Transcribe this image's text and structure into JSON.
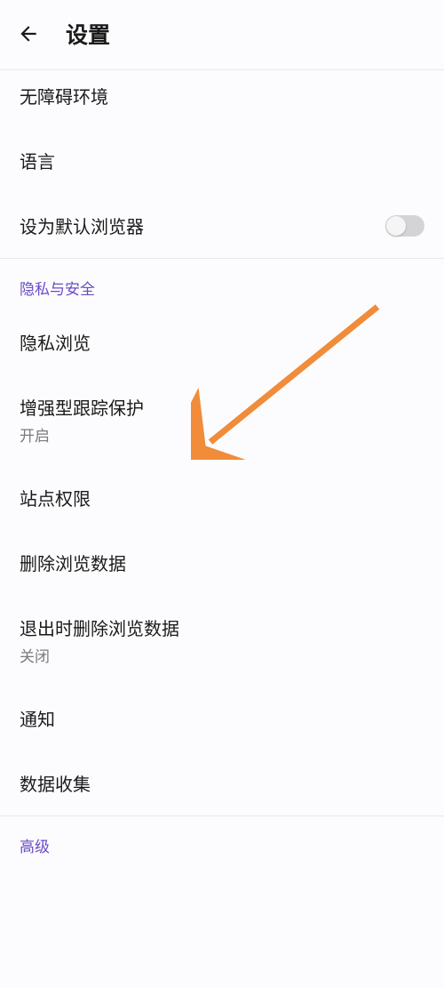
{
  "header": {
    "title": "设置"
  },
  "items": {
    "accessibility": {
      "label": "无障碍环境"
    },
    "language": {
      "label": "语言"
    },
    "default_browser": {
      "label": "设为默认浏览器",
      "toggle": "off"
    }
  },
  "sections": {
    "privacy_security": {
      "title": "隐私与安全"
    },
    "advanced": {
      "title": "高级"
    }
  },
  "privacy_items": {
    "private_browsing": {
      "label": "隐私浏览"
    },
    "enhanced_tracking": {
      "label": "增强型跟踪保护",
      "sub": "开启"
    },
    "site_permissions": {
      "label": "站点权限"
    },
    "delete_browsing_data": {
      "label": "删除浏览数据"
    },
    "delete_on_quit": {
      "label": "退出时删除浏览数据",
      "sub": "关闭"
    },
    "notifications": {
      "label": "通知"
    },
    "data_collection": {
      "label": "数据收集"
    }
  },
  "annotation": {
    "arrow_color": "#f08c3a"
  }
}
